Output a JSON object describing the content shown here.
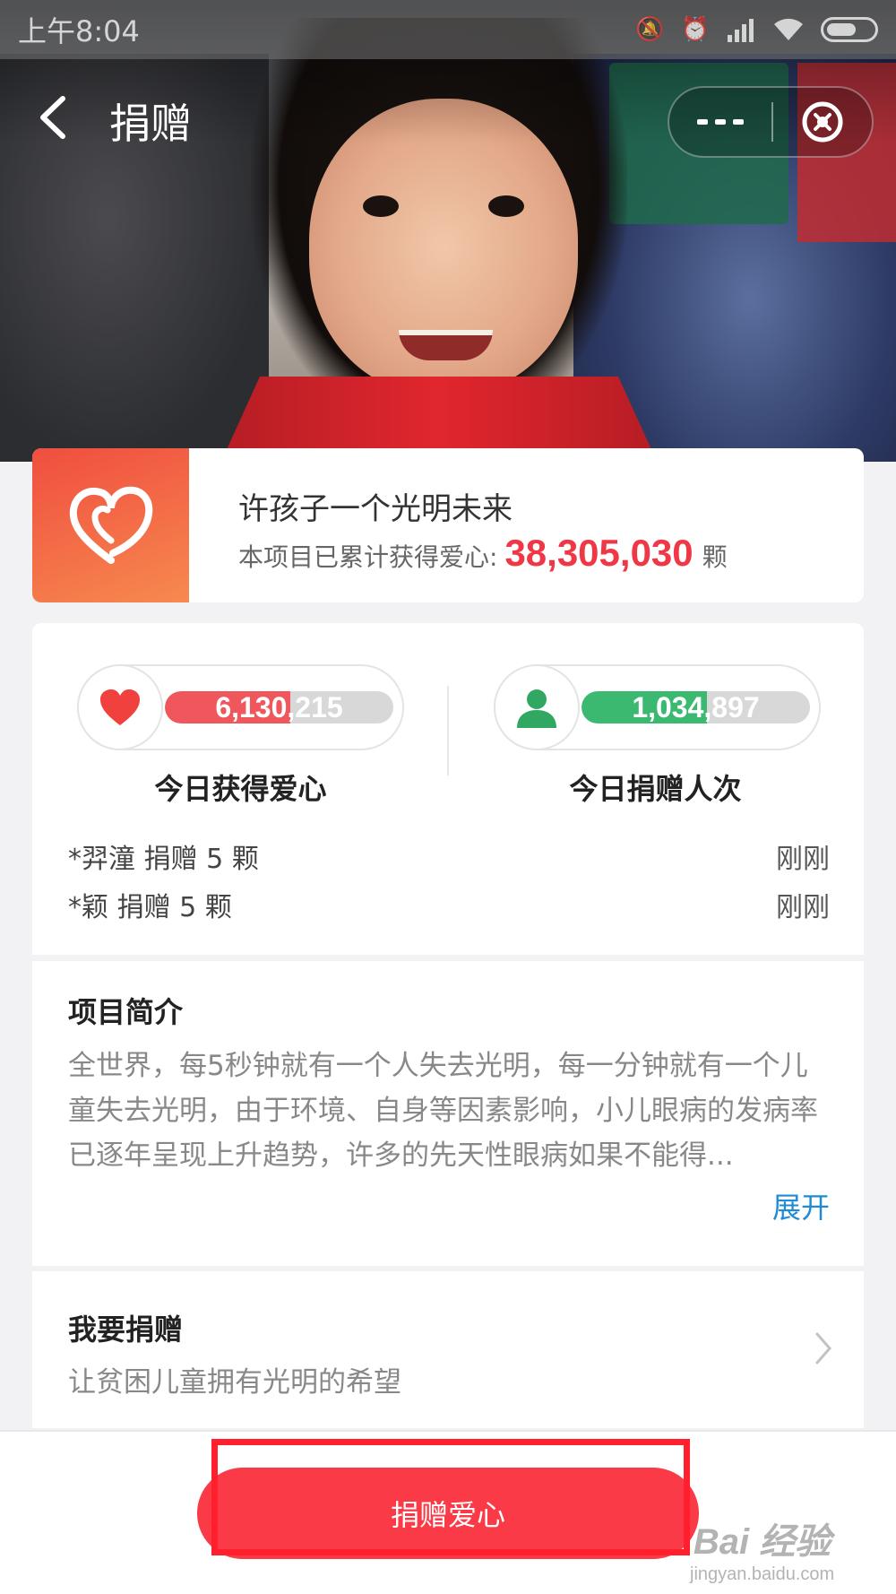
{
  "status_bar": {
    "time": "上午8:04",
    "icons": [
      "mute-icon",
      "alarm-icon",
      "hd-signal-icon",
      "wifi-icon",
      "battery-icon"
    ]
  },
  "nav": {
    "title": "捐赠",
    "back_icon": "chevron-left-icon",
    "more_icon": "more-dots-icon",
    "close_icon": "close-circle-icon"
  },
  "project": {
    "title": "许孩子一个光明未来",
    "hearts_label": "本项目已累计获得爱心:",
    "hearts_total": "38,305,030",
    "hearts_unit": "颗",
    "logo_icon": "heart-logo-icon",
    "logo_gradient": [
      "#f04e3f",
      "#f7894f"
    ]
  },
  "stats": {
    "today_hearts": {
      "value": "6,130,215",
      "label": "今日获得爱心",
      "fill": 0.55,
      "color": "#f0575c",
      "icon": "heart-icon"
    },
    "today_donors": {
      "value": "1,034,897",
      "label": "今日捐赠人次",
      "fill": 0.55,
      "color": "#3cb970",
      "icon": "person-icon"
    }
  },
  "recent_donations": [
    {
      "text": "*羿潼 捐赠 5 颗",
      "time": "刚刚"
    },
    {
      "text": "*颖 捐赠 5 颗",
      "time": "刚刚"
    }
  ],
  "intro": {
    "title": "项目简介",
    "text": "全世界，每5秒钟就有一个人失去光明，每一分钟就有一个儿童失去光明，由于环境、自身等因素影响，小儿眼病的发病率已逐年呈现上升趋势，许多的先天性眼病如果不能得...",
    "expand": "展开"
  },
  "donate_section": {
    "title": "我要捐赠",
    "subtitle": "让贫困儿童拥有光明的希望",
    "chevron_icon": "chevron-right-icon"
  },
  "bottom": {
    "button": "捐赠爱心",
    "button_color": "#fa3a46",
    "watermark_1": "Bai 经验",
    "watermark_2": "jingyan.baidu.com"
  }
}
